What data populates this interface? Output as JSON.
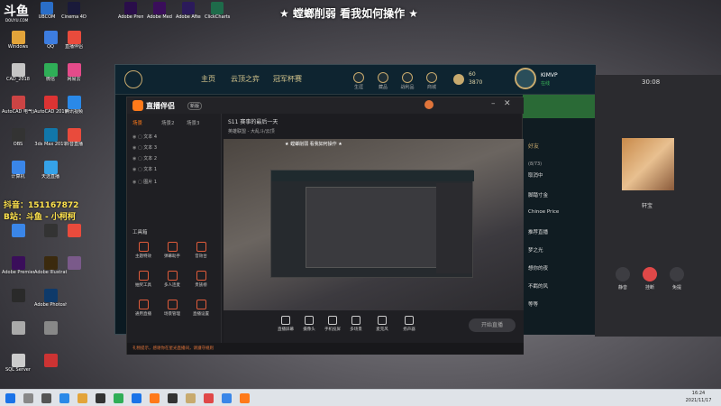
{
  "banner": "★ 螳螂削弱 看我如何操作 ★",
  "logo": "斗鱼",
  "logo_sub": "DOUYU.COM",
  "promo": {
    "line1": "抖音：151167872",
    "line2": "B站：斗鱼 - 小柯柯"
  },
  "desktop_icons": [
    "Windows",
    "CAD_2018",
    "AutoCAD 电气设计",
    "AutoCAD 2019",
    "3ds Max 2019",
    "OBS",
    "抖音直播",
    "天选直播",
    "Adobe Premiere",
    "Adobe Illustrator",
    "Adobe Photoshop",
    "计算机",
    "QQ",
    "微信",
    "网易云",
    "直播伴侣",
    "腾讯视频",
    "SQL Server"
  ],
  "top_icons": [
    "UBCOM",
    "Cinema 4D",
    "Adobe Premiere",
    "Adobe Media",
    "Adobe After Effects",
    "ClickCharts"
  ],
  "lol": {
    "tabs": [
      "主页",
      "云顶之弈",
      "冠军杯赛"
    ],
    "small": [
      "生涯",
      "藏品",
      "战利品",
      "商城"
    ],
    "currency_be": "60",
    "currency_rp": "3870",
    "username": "KIMVP",
    "status": "在线",
    "friends_header": "好友",
    "friends_count": "(8/73)",
    "friends": [
      "取消中",
      "脚踏寸金",
      "Chinoe Price",
      "推荐直播",
      "梦之光",
      "想你的夜",
      "不羁的风",
      "等等"
    ]
  },
  "douyu": {
    "title": "直播伴侣",
    "version": "新版",
    "scene_tabs": [
      "场景",
      "场景2",
      "场景3"
    ],
    "scenes": [
      "文本 4",
      "文本 3",
      "文本 2",
      "文本 1",
      "图片 1"
    ],
    "stream_title": "S11 赛事的最后一天",
    "game": "英雄联盟 - 大乱斗/云顶",
    "tools_header": "工具箱",
    "tools": [
      "主题特效",
      "弹幕助手",
      "音效台",
      "抽奖工具",
      "多人连麦",
      "贵族榜",
      "通用直播",
      "场景管理",
      "直播设置"
    ],
    "bottom": [
      "直播屏幕",
      "摄像头",
      "手机投屏",
      "多场景",
      "麦克风",
      "扬声器"
    ],
    "start_btn": "开始直播",
    "status_text": "礼物提示，感谢你在星光直播间，请遵守规则"
  },
  "call": {
    "timer": "30:08",
    "name": "轩宝",
    "buttons": [
      "静音",
      "挂断",
      "免提"
    ]
  },
  "taskbar": {
    "time": "16:24",
    "date": "2021/11/17"
  }
}
